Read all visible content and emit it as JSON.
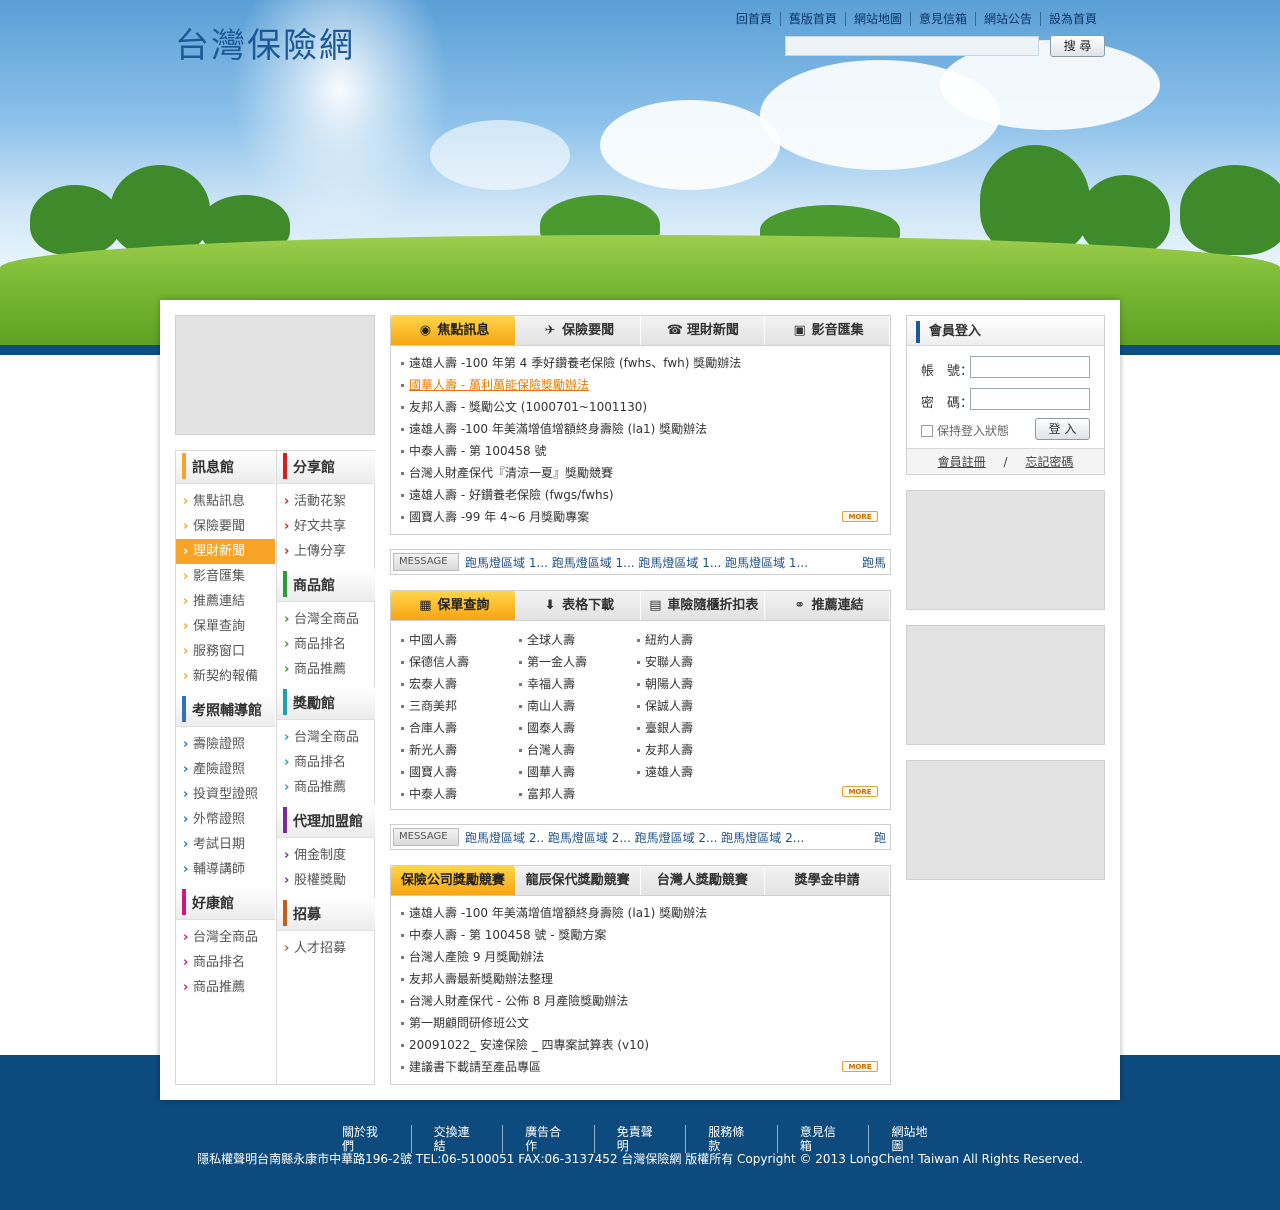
{
  "header": {
    "logo": "台灣保險網",
    "nav": [
      "回首頁",
      "舊版首頁",
      "網站地圖",
      "意見信箱",
      "網站公告",
      "設為首頁"
    ],
    "search_button": "搜 尋"
  },
  "left_nav": {
    "col1": [
      {
        "title": "訊息館",
        "color": "#f7a325",
        "items": [
          "焦點訊息",
          "保險要聞",
          "理財新聞",
          "影音匯集",
          "推薦連結",
          "保單查詢",
          "服務窗口",
          "新契約報備"
        ],
        "active": 2
      },
      {
        "title": "考照輔導館",
        "color": "#2f6fbf",
        "items": [
          "壽險證照",
          "產險證照",
          "投資型證照",
          "外幣證照",
          "考試日期",
          "輔導講師"
        ]
      },
      {
        "title": "好康館",
        "color": "#d0167a",
        "items": [
          "台灣全商品",
          "商品排名",
          "商品推薦"
        ]
      }
    ],
    "col2": [
      {
        "title": "分享館",
        "color": "#d62020",
        "items": [
          "活動花絮",
          "好文共享",
          "上傳分享"
        ]
      },
      {
        "title": "商品館",
        "color": "#2f9a3a",
        "items": [
          "台灣全商品",
          "商品排名",
          "商品推薦"
        ]
      },
      {
        "title": "獎勵館",
        "color": "#1fa0b0",
        "items": [
          "台灣全商品",
          "商品排名",
          "商品推薦"
        ]
      },
      {
        "title": "代理加盟館",
        "color": "#7a2a9a",
        "items": [
          "佣金制度",
          "股權獎勵"
        ]
      },
      {
        "title": "招募",
        "color": "#c0601a",
        "items": [
          "人才招募"
        ]
      }
    ]
  },
  "news_panel": {
    "tabs": [
      {
        "label": "焦點訊息",
        "icon": "◉"
      },
      {
        "label": "保險要聞",
        "icon": "✈"
      },
      {
        "label": "理財新聞",
        "icon": "☎"
      },
      {
        "label": "影音匯集",
        "icon": "▣"
      }
    ],
    "items": [
      "遠雄人壽 -100 年第 4 季好鑽養老保險 (fwhs、fwh) 獎勵辦法",
      "國華人壽 - 萬利萬能保險獎勵辦法",
      "友邦人壽 - 獎勵公文 (1000701~1001130)",
      "遠雄人壽 -100 年美滿增值增額終身壽險 (la1) 獎勵辦法",
      "中泰人壽 - 第 100458 號",
      "台灣人財產保代『清涼一夏』獎勵競賽",
      "遠雄人壽 - 好鑽養老保險 (fwgs/fwhs)",
      "國寶人壽 -99 年 4~6 月獎勵專案"
    ],
    "highlight": 1,
    "more": "MORE"
  },
  "marquee1": {
    "label": "MESSAGE >",
    "text": "跑馬燈區域 1... 跑馬燈區域 1... 跑馬燈區域 1... 跑馬燈區域 1...",
    "tail": "跑馬"
  },
  "policy_panel": {
    "tabs": [
      {
        "label": "保單查詢",
        "icon": "▦"
      },
      {
        "label": "表格下載",
        "icon": "⬇"
      },
      {
        "label": "車險隨櫃折扣表",
        "icon": "▤"
      },
      {
        "label": "推薦連結",
        "icon": "⚭"
      }
    ],
    "companies": [
      [
        "中國人壽",
        "全球人壽",
        "紐約人壽"
      ],
      [
        "保德信人壽",
        "第一金人壽",
        "安聯人壽"
      ],
      [
        "宏泰人壽",
        "幸福人壽",
        "朝陽人壽"
      ],
      [
        "三商美邦",
        "南山人壽",
        "保誠人壽"
      ],
      [
        "合庫人壽",
        "國泰人壽",
        "臺銀人壽"
      ],
      [
        "新光人壽",
        "台灣人壽",
        "友邦人壽"
      ],
      [
        "國寶人壽",
        "國華人壽",
        "遠雄人壽"
      ],
      [
        "中泰人壽",
        "富邦人壽",
        ""
      ]
    ],
    "more": "MORE"
  },
  "marquee2": {
    "label": "MESSAGE >",
    "text": "跑馬燈區域 2.. 跑馬燈區域 2... 跑馬燈區域 2... 跑馬燈區域 2...",
    "tail": "跑"
  },
  "contest_panel": {
    "tabs": [
      "保險公司獎勵競賽",
      "龍辰保代獎勵競賽",
      "台灣人獎勵競賽",
      "獎學金申請"
    ],
    "items": [
      "遠雄人壽 -100 年美滿增值增額終身壽險 (la1) 獎勵辦法",
      "中泰人壽 - 第 100458 號 - 獎勵方案",
      "台灣人產險 9 月獎勵辦法",
      "友邦人壽最新獎勵辦法整理",
      "台灣人財產保代 - 公佈 8 月產險獎勵辦法",
      "第一期顧問研修班公文",
      "20091022_ 安達保險 _ 四專案試算表 (v10)",
      "建議書下載請至產品專區"
    ],
    "more": "MORE"
  },
  "login": {
    "title": "會員登入",
    "account_label": "帳　號：",
    "password_label": "密　碼：",
    "keep_label": "保持登入狀態",
    "login_button": "登 入",
    "register": "會員註冊",
    "separator": "/",
    "forgot": "忘記密碼"
  },
  "footer": {
    "nav": [
      "關於我們",
      "交換連結",
      "廣告合作",
      "免責聲明",
      "服務條款",
      "意見信箱",
      "網站地圖"
    ],
    "copyright": "隱私權聲明台南縣永康市中華路196-2號 TEL:06-5100051 FAX:06-3137452 台灣保險網 版權所有 Copyright © 2013 LongChen! Taiwan All Rights Reserved."
  }
}
